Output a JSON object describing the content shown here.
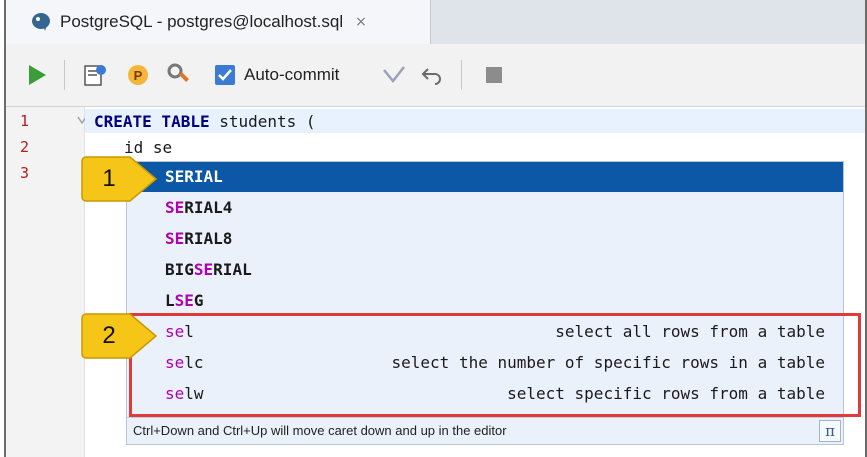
{
  "tab": {
    "title": "PostgreSQL - postgres@localhost.sql",
    "close_glyph": "×",
    "icon": "postgresql-elephant-icon"
  },
  "toolbar": {
    "autocommit_label": "Auto-commit",
    "autocommit_checked": true,
    "icons": [
      "run-icon",
      "explain-plan-icon",
      "p-badge-icon",
      "settings-icon",
      "checkmark-icon",
      "undo-icon",
      "stop-icon"
    ]
  },
  "editor": {
    "line_numbers": [
      "1",
      "2",
      "3"
    ],
    "line1_kw": "CREATE TABLE",
    "line1_rest": " students (",
    "line2": "id se"
  },
  "completion": {
    "items": [
      {
        "pre": "",
        "hl": "SE",
        "post": "RIAL",
        "selected": true
      },
      {
        "pre": "",
        "hl": "SE",
        "post": "RIAL4",
        "selected": false
      },
      {
        "pre": "",
        "hl": "SE",
        "post": "RIAL8",
        "selected": false
      },
      {
        "pre": "BIG",
        "hl": "SE",
        "post": "RIAL",
        "selected": false
      },
      {
        "pre": "L",
        "hl": "SE",
        "post": "G",
        "selected": false
      }
    ],
    "live_templates": [
      {
        "hl": "se",
        "post": "l",
        "desc": "select all rows from a table"
      },
      {
        "hl": "se",
        "post": "lc",
        "desc": "select the number of specific rows in a table"
      },
      {
        "hl": "se",
        "post": "lw",
        "desc": "select specific rows from a table"
      }
    ],
    "footer_hint": "Ctrl+Down and Ctrl+Up will move caret down and up in the editor",
    "pi_glyph": "π"
  },
  "callouts": {
    "one": "1",
    "two": "2"
  },
  "colors": {
    "selection": "#0d58a6",
    "highlight": "#b000b0",
    "redbox": "#e03a3a",
    "callout": "#f5c518"
  }
}
